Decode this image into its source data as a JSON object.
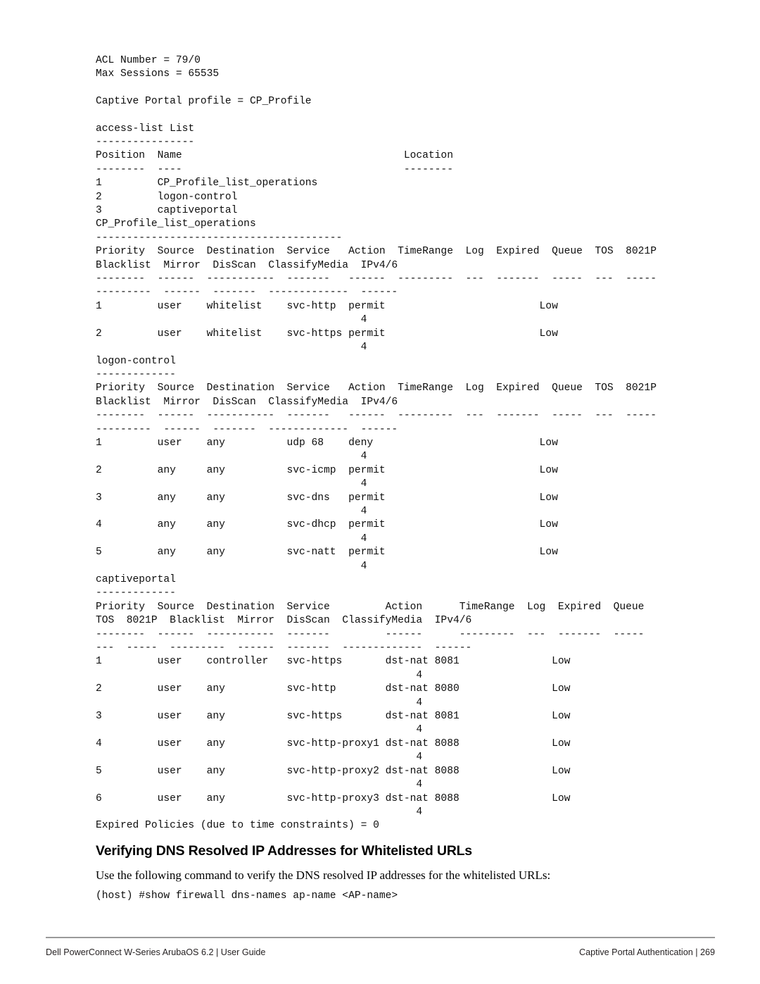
{
  "document": {
    "page_number": "269",
    "footer_left": "Dell PowerConnect W-Series ArubaOS 6.2 | User Guide",
    "footer_right": "Captive Portal Authentication | 269"
  },
  "cli_output": {
    "lines": [
      "ACL Number = 79/0",
      "Max Sessions = 65535",
      "",
      "Captive Portal profile = CP_Profile",
      "",
      "access-list List",
      "----------------",
      "Position  Name                                    Location",
      "--------  ----                                    --------",
      "1         CP_Profile_list_operations",
      "2         logon-control",
      "3         captiveportal",
      "CP_Profile_list_operations",
      "----------------------------------------",
      "Priority  Source  Destination  Service   Action  TimeRange  Log  Expired  Queue  TOS  8021P",
      "Blacklist  Mirror  DisScan  ClassifyMedia  IPv4/6",
      "--------  ------  -----------  -------   ------  ---------  ---  -------  -----  ---  -----",
      "---------  ------  -------  -------------  ------",
      "1         user    whitelist    svc-http  permit                         Low",
      "                                           4",
      "2         user    whitelist    svc-https permit                         Low",
      "                                           4",
      "logon-control",
      "-------------",
      "Priority  Source  Destination  Service   Action  TimeRange  Log  Expired  Queue  TOS  8021P",
      "Blacklist  Mirror  DisScan  ClassifyMedia  IPv4/6",
      "--------  ------  -----------  -------   ------  ---------  ---  -------  -----  ---  -----",
      "---------  ------  -------  -------------  ------",
      "1         user    any          udp 68    deny                           Low",
      "                                           4",
      "2         any     any          svc-icmp  permit                         Low",
      "                                           4",
      "3         any     any          svc-dns   permit                         Low",
      "                                           4",
      "4         any     any          svc-dhcp  permit                         Low",
      "                                           4",
      "5         any     any          svc-natt  permit                         Low",
      "                                           4",
      "captiveportal",
      "-------------",
      "Priority  Source  Destination  Service         Action      TimeRange  Log  Expired  Queue",
      "TOS  8021P  Blacklist  Mirror  DisScan  ClassifyMedia  IPv4/6",
      "--------  ------  -----------  -------         ------      ---------  ---  -------  -----",
      "---  -----  ---------  ------  -------  -------------  ------",
      "1         user    controller   svc-https       dst-nat 8081               Low",
      "                                                    4",
      "2         user    any          svc-http        dst-nat 8080               Low",
      "                                                    4",
      "3         user    any          svc-https       dst-nat 8081               Low",
      "                                                    4",
      "4         user    any          svc-http-proxy1 dst-nat 8088               Low",
      "                                                    4",
      "5         user    any          svc-http-proxy2 dst-nat 8088               Low",
      "                                                    4",
      "6         user    any          svc-http-proxy3 dst-nat 8088               Low",
      "                                                    4",
      "Expired Policies (due to time constraints) = 0"
    ],
    "acl_number": "79/0",
    "max_sessions": "65535",
    "captive_portal_profile": "CP_Profile",
    "access_list": {
      "title": "access-list List",
      "columns": [
        "Position",
        "Name",
        "Location"
      ],
      "rows": [
        {
          "position": "1",
          "name": "CP_Profile_list_operations",
          "location": ""
        },
        {
          "position": "2",
          "name": "logon-control",
          "location": ""
        },
        {
          "position": "3",
          "name": "captiveportal",
          "location": ""
        }
      ]
    },
    "policies": [
      {
        "name": "CP_Profile_list_operations",
        "columns": [
          "Priority",
          "Source",
          "Destination",
          "Service",
          "Action",
          "TimeRange",
          "Log",
          "Expired",
          "Queue",
          "TOS",
          "8021P",
          "Blacklist",
          "Mirror",
          "DisScan",
          "ClassifyMedia",
          "IPv4/6"
        ],
        "rows": [
          {
            "priority": "1",
            "source": "user",
            "destination": "whitelist",
            "service": "svc-http",
            "action": "permit",
            "queue": "Low",
            "ipv46": "4"
          },
          {
            "priority": "2",
            "source": "user",
            "destination": "whitelist",
            "service": "svc-https",
            "action": "permit",
            "queue": "Low",
            "ipv46": "4"
          }
        ]
      },
      {
        "name": "logon-control",
        "columns": [
          "Priority",
          "Source",
          "Destination",
          "Service",
          "Action",
          "TimeRange",
          "Log",
          "Expired",
          "Queue",
          "TOS",
          "8021P",
          "Blacklist",
          "Mirror",
          "DisScan",
          "ClassifyMedia",
          "IPv4/6"
        ],
        "rows": [
          {
            "priority": "1",
            "source": "user",
            "destination": "any",
            "service": "udp 68",
            "action": "deny",
            "queue": "Low",
            "ipv46": "4"
          },
          {
            "priority": "2",
            "source": "any",
            "destination": "any",
            "service": "svc-icmp",
            "action": "permit",
            "queue": "Low",
            "ipv46": "4"
          },
          {
            "priority": "3",
            "source": "any",
            "destination": "any",
            "service": "svc-dns",
            "action": "permit",
            "queue": "Low",
            "ipv46": "4"
          },
          {
            "priority": "4",
            "source": "any",
            "destination": "any",
            "service": "svc-dhcp",
            "action": "permit",
            "queue": "Low",
            "ipv46": "4"
          },
          {
            "priority": "5",
            "source": "any",
            "destination": "any",
            "service": "svc-natt",
            "action": "permit",
            "queue": "Low",
            "ipv46": "4"
          }
        ]
      },
      {
        "name": "captiveportal",
        "columns": [
          "Priority",
          "Source",
          "Destination",
          "Service",
          "Action",
          "TimeRange",
          "Log",
          "Expired",
          "Queue",
          "TOS",
          "8021P",
          "Blacklist",
          "Mirror",
          "DisScan",
          "ClassifyMedia",
          "IPv4/6"
        ],
        "rows": [
          {
            "priority": "1",
            "source": "user",
            "destination": "controller",
            "service": "svc-https",
            "action": "dst-nat 8081",
            "queue": "Low",
            "ipv46": "4"
          },
          {
            "priority": "2",
            "source": "user",
            "destination": "any",
            "service": "svc-http",
            "action": "dst-nat 8080",
            "queue": "Low",
            "ipv46": "4"
          },
          {
            "priority": "3",
            "source": "user",
            "destination": "any",
            "service": "svc-https",
            "action": "dst-nat 8081",
            "queue": "Low",
            "ipv46": "4"
          },
          {
            "priority": "4",
            "source": "user",
            "destination": "any",
            "service": "svc-http-proxy1",
            "action": "dst-nat 8088",
            "queue": "Low",
            "ipv46": "4"
          },
          {
            "priority": "5",
            "source": "user",
            "destination": "any",
            "service": "svc-http-proxy2",
            "action": "dst-nat 8088",
            "queue": "Low",
            "ipv46": "4"
          },
          {
            "priority": "6",
            "source": "user",
            "destination": "any",
            "service": "svc-http-proxy3",
            "action": "dst-nat 8088",
            "queue": "Low",
            "ipv46": "4"
          }
        ]
      }
    ],
    "expired_policies": "Expired Policies (due to time constraints) = 0"
  },
  "section": {
    "heading": "Verifying DNS Resolved IP Addresses for Whitelisted URLs",
    "paragraph": "Use the following command to verify the DNS resolved IP addresses for the whitelisted URLs:",
    "command": "(host) #show firewall dns-names ap-name <AP-name>"
  }
}
